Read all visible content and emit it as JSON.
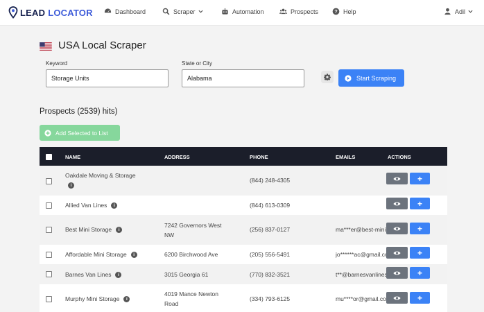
{
  "brand": {
    "word1": "LEAD",
    "word2": "LOCATOR"
  },
  "nav": {
    "dashboard": "Dashboard",
    "scraper": "Scraper",
    "automation": "Automation",
    "prospects": "Prospects",
    "help": "Help",
    "user": "Adil"
  },
  "page": {
    "title": "USA Local Scraper"
  },
  "form": {
    "keyword_label": "Keyword",
    "keyword_value": "Storage Units",
    "location_label": "State or City",
    "location_value": "Alabama",
    "start_label": "Start Scraping"
  },
  "results": {
    "title": "Prospects (2539) hits)",
    "add_label": "Add Selected to List"
  },
  "table": {
    "headers": {
      "name": "NAME",
      "address": "ADDRESS",
      "phone": "PHONE",
      "emails": "EMAILS",
      "actions": "ACTIONS"
    },
    "rows": [
      {
        "name": "Oakdale Moving & Storage",
        "address1": "",
        "address2": "",
        "phone": "(844) 248-4305",
        "email": ""
      },
      {
        "name": "Allied Van Lines",
        "address1": "",
        "address2": "",
        "phone": "(844) 613-0309",
        "email": ""
      },
      {
        "name": "Best Mini Storage",
        "address1": "7242 Governors West",
        "address2": "NW",
        "phone": "(256) 837-0127",
        "email": "ma***er@best-mini"
      },
      {
        "name": "Affordable Mini Storage",
        "address1": "6200 Birchwood Ave",
        "address2": "",
        "phone": "(205) 556-5491",
        "email": "jo******ac@gmail.com"
      },
      {
        "name": "Barnes Van Lines",
        "address1": "3015 Georgia 61",
        "address2": "",
        "phone": "(770) 832-3521",
        "email": "t**@barnesvanlines.com"
      },
      {
        "name": "Murphy Mini Storage",
        "address1": "4019 Mance Newton",
        "address2": "Road",
        "phone": "(334) 793-6125",
        "email": "mu****or@gmail.com"
      }
    ]
  },
  "colors": {
    "primary": "#3b82f6",
    "success_light": "#86d79c",
    "table_header": "#1b1e2a",
    "brand_dark": "#17224f",
    "brand_blue": "#3d5bd9"
  },
  "icons": {
    "brand": "map-pin-icon",
    "dashboard": "gauge-icon",
    "scraper": "search-icon",
    "automation": "robot-icon",
    "prospects": "users-icon",
    "help": "question-circle-icon",
    "user": "user-icon",
    "settings": "gear-icon",
    "start": "play-circle-icon",
    "add": "plus-circle-icon",
    "view": "eye-icon",
    "add_row": "plus-icon",
    "info": "info-icon"
  }
}
